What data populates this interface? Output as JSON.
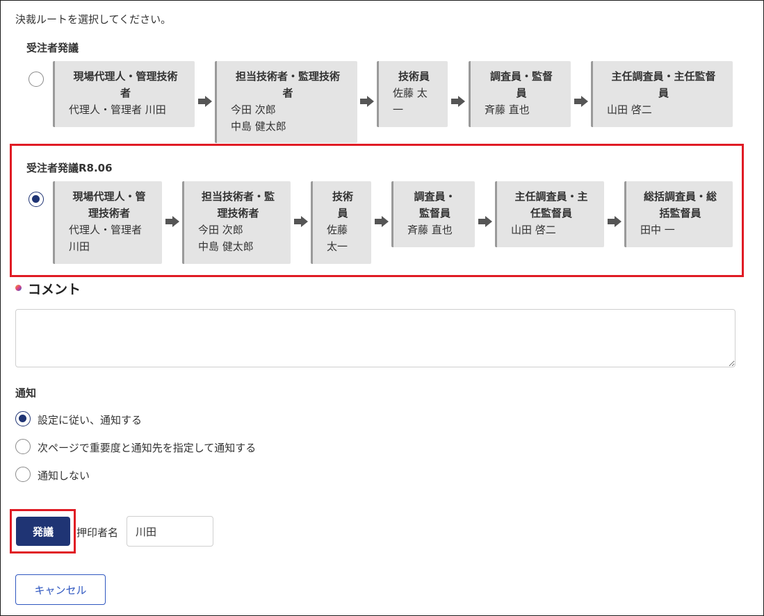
{
  "instruction": "決裁ルートを選択してください。",
  "routes": [
    {
      "title": "受注者発議",
      "selected": false,
      "steps": [
        {
          "role": "現場代理人・管理技術\n者",
          "names": "代理人・管理者 川田"
        },
        {
          "role": "担当技術者・監理技術\n者",
          "names": "今田 次郎\n中島 健太郎"
        },
        {
          "role": "技術員",
          "names": "佐藤 太\n一"
        },
        {
          "role": "調査員・監督\n員",
          "names": "斉藤 直也"
        },
        {
          "role": "主任調査員・主任監督\n員",
          "names": "山田 啓二"
        }
      ]
    },
    {
      "title": "受注者発議R8.06",
      "selected": true,
      "steps": [
        {
          "role": "現場代理人・管\n理技術者",
          "names": "代理人・管理者\n川田"
        },
        {
          "role": "担当技術者・監\n理技術者",
          "names": "今田 次郎\n中島 健太郎"
        },
        {
          "role": "技術\n員",
          "names": "佐藤\n太一"
        },
        {
          "role": "調査員・\n監督員",
          "names": "斉藤 直也"
        },
        {
          "role": "主任調査員・主\n任監督員",
          "names": "山田 啓二"
        },
        {
          "role": "総括調査員・総\n括監督員",
          "names": "田中 一"
        }
      ]
    }
  ],
  "comment": {
    "title": "コメント",
    "value": ""
  },
  "notification": {
    "title": "通知",
    "options": [
      {
        "label": "設定に従い、通知する",
        "selected": true
      },
      {
        "label": "次ページで重要度と通知先を指定して通知する",
        "selected": false
      },
      {
        "label": "通知しない",
        "selected": false
      }
    ]
  },
  "actions": {
    "issue_label": "発議",
    "stamp_label": "押印者名",
    "stamp_value": "川田",
    "cancel_label": "キャンセル"
  },
  "colors": {
    "accent": "#1f3474",
    "highlight": "#e01b24",
    "link": "#2f57c0",
    "box_bg": "#e4e4e4"
  }
}
